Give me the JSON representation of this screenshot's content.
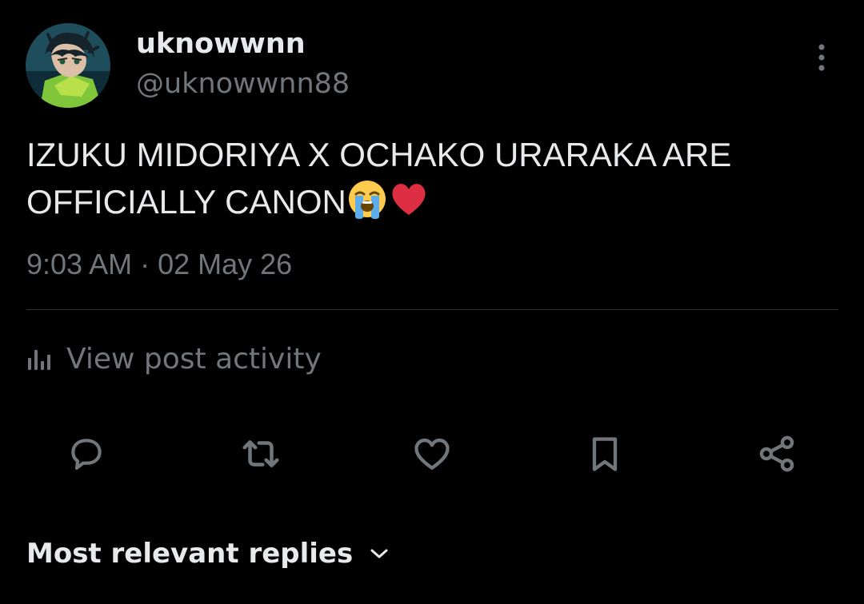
{
  "author": {
    "display_name": "uknowwnn",
    "handle": "@uknowwnn88"
  },
  "post": {
    "text": "IZUKU MIDORIYA X OCHAKO URARAKA ARE OFFICIALLY CANON",
    "emojis": [
      "loudly-crying-face",
      "red-heart"
    ],
    "timestamp": "9:03 AM · 02 May 26"
  },
  "activity": {
    "label": "View post activity",
    "icon": "analytics-icon"
  },
  "actions": [
    {
      "name": "reply",
      "icon": "reply-icon"
    },
    {
      "name": "repost",
      "icon": "repost-icon"
    },
    {
      "name": "like",
      "icon": "heart-icon"
    },
    {
      "name": "bookmark",
      "icon": "bookmark-icon"
    },
    {
      "name": "share",
      "icon": "share-icon"
    }
  ],
  "replies": {
    "sort_label": "Most relevant replies"
  },
  "colors": {
    "background": "#000000",
    "primary_text": "#e7e9ea",
    "secondary_text": "#71767b",
    "divider": "#2f3336",
    "icon": "#71767b"
  }
}
